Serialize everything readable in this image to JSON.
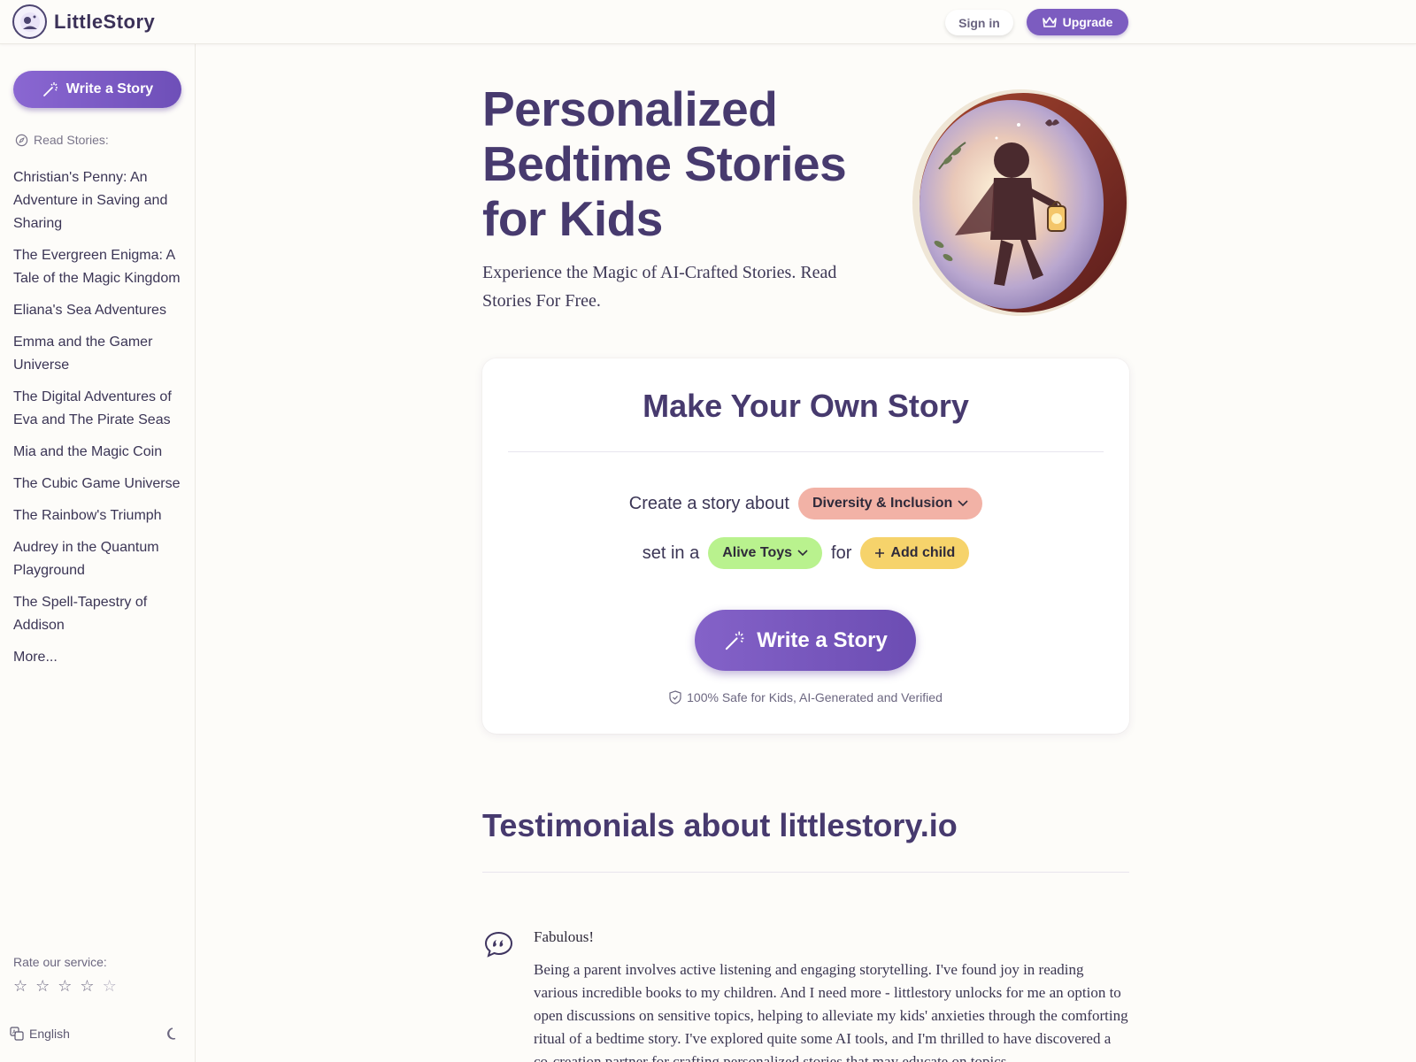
{
  "brand": {
    "name": "LittleStory"
  },
  "header": {
    "signin_label": "Sign in",
    "upgrade_label": "Upgrade"
  },
  "sidebar": {
    "write_label": "Write a Story",
    "read_label": "Read Stories:",
    "stories": [
      "Christian's Penny: An Adventure in Saving and Sharing",
      "The Evergreen Enigma: A Tale of the Magic Kingdom",
      "Eliana's Sea Adventures",
      "Emma and the Gamer Universe",
      "The Digital Adventures of Eva and The Pirate Seas",
      "Mia and the Magic Coin",
      "The Cubic Game Universe",
      "The Rainbow's Triumph",
      "Audrey in the Quantum Playground",
      "The Spell-Tapestry of Addison"
    ],
    "more_label": "More...",
    "rate_label": "Rate our service:",
    "rating": {
      "filled": 0,
      "max": 5
    },
    "language": "English"
  },
  "hero": {
    "title": "Personalized Bedtime Stories for Kids",
    "subtitle": "Experience the Magic of AI-Crafted Stories. Read Stories For Free."
  },
  "maker": {
    "title": "Make Your Own Story",
    "create_prefix": "Create a story about",
    "topic": "Diversity & Inclusion",
    "set_in_prefix": "set in a",
    "setting": "Alive Toys",
    "for_label": "for",
    "add_child_label": "Add child",
    "write_label": "Write a Story",
    "safe_note": "100% Safe for Kids, AI-Generated and Verified"
  },
  "testimonials": {
    "title": "Testimonials about littlestory.io",
    "items": [
      {
        "heading": "Fabulous!",
        "body": "Being a parent involves active listening and engaging storytelling. I've found joy in reading various incredible books to my children. And I need more - littlestory unlocks for me an option to open discussions on sensitive topics, helping to alleviate my kids' anxieties through the comforting ritual of a bedtime story. I've explored quite some AI tools, and I'm thrilled to have discovered a co-creation partner for crafting personalized stories that may educate on topics"
      }
    ]
  },
  "colors": {
    "accent": "#7c5cc0",
    "heading": "#473a6e",
    "topic_pill": "#f2b2a6",
    "setting_pill": "#b9f28e",
    "child_pill": "#f6d36b"
  },
  "icons": {
    "brand": "logo-mark-icon",
    "upgrade": "crown-icon",
    "write": "magic-wand-icon",
    "read": "compass-icon",
    "dropdown": "chevron-down-icon",
    "add": "plus-icon",
    "safe": "shield-check-icon",
    "rating": "star-icon",
    "language": "translate-icon",
    "theme": "moon-icon",
    "quote": "quote-bubble-icon"
  }
}
